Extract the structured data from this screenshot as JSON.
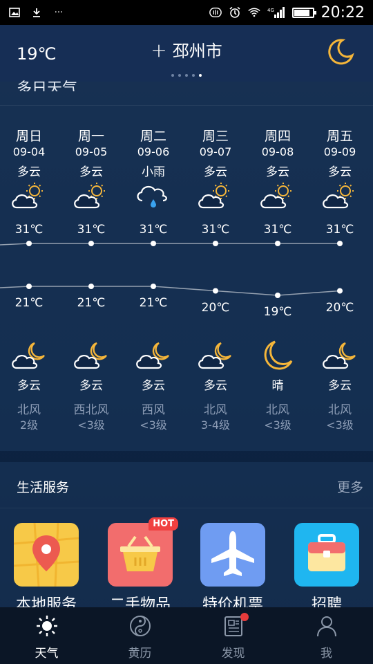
{
  "status_bar": {
    "time": "20:22",
    "network": "4G",
    "icons": [
      "image-icon",
      "download-icon",
      "more-icon",
      "nfc-icon",
      "alarm-icon",
      "wifi-icon",
      "signal-icon",
      "battery-icon"
    ]
  },
  "header": {
    "current_temp": "19℃",
    "city": "邳州市",
    "add_icon": "+",
    "page_count": 5,
    "active_page": 5,
    "moon_icon": "moon-icon"
  },
  "forecast": {
    "title": "多日天气",
    "days": [
      {
        "name": "周日",
        "date": "09-04",
        "day_cond": "多云",
        "day_icon": "partly-cloudy-sun",
        "high": "31℃",
        "low": "21℃",
        "night_icon": "cloud-moon",
        "night_cond": "多云",
        "wind_dir": "北风",
        "wind_level": "2级"
      },
      {
        "name": "周一",
        "date": "09-05",
        "day_cond": "多云",
        "day_icon": "partly-cloudy-sun",
        "high": "31℃",
        "low": "21℃",
        "night_icon": "cloud-moon",
        "night_cond": "多云",
        "wind_dir": "西北风",
        "wind_level": "<3级"
      },
      {
        "name": "周二",
        "date": "09-06",
        "day_cond": "小雨",
        "day_icon": "rain",
        "high": "31℃",
        "low": "21℃",
        "night_icon": "cloud-moon",
        "night_cond": "多云",
        "wind_dir": "西风",
        "wind_level": "<3级"
      },
      {
        "name": "周三",
        "date": "09-07",
        "day_cond": "多云",
        "day_icon": "partly-cloudy-sun",
        "high": "31℃",
        "low": "20℃",
        "night_icon": "cloud-moon",
        "night_cond": "多云",
        "wind_dir": "北风",
        "wind_level": "3-4级"
      },
      {
        "name": "周四",
        "date": "09-08",
        "day_cond": "多云",
        "day_icon": "partly-cloudy-sun",
        "high": "31℃",
        "low": "19℃",
        "night_icon": "moon",
        "night_cond": "晴",
        "wind_dir": "北风",
        "wind_level": "<3级"
      },
      {
        "name": "周五",
        "date": "09-09",
        "day_cond": "多云",
        "day_icon": "partly-cloudy-sun",
        "high": "31℃",
        "low": "20℃",
        "night_icon": "cloud-moon",
        "night_cond": "多云",
        "wind_dir": "北风",
        "wind_level": "<3级"
      }
    ],
    "high_values": [
      31,
      31,
      31,
      31,
      31,
      31
    ],
    "low_values": [
      21,
      21,
      21,
      20,
      19,
      20
    ]
  },
  "services": {
    "title": "生活服务",
    "more": "更多",
    "items": [
      {
        "label": "本地服务",
        "icon": "map-pin-icon",
        "color": "#f7c948"
      },
      {
        "label": "二手物品",
        "icon": "basket-icon",
        "color": "#f26d6d",
        "badge": "HOT"
      },
      {
        "label": "特价机票",
        "icon": "airplane-icon",
        "color": "#6f9cf2"
      },
      {
        "label": "招聘",
        "icon": "briefcase-icon",
        "color": "#1fb6f0"
      }
    ]
  },
  "tabs": [
    {
      "label": "天气",
      "icon": "sun-icon",
      "active": true
    },
    {
      "label": "黄历",
      "icon": "yin-yang-icon",
      "active": false
    },
    {
      "label": "发现",
      "icon": "news-icon",
      "active": false,
      "badge_dot": true
    },
    {
      "label": "我",
      "icon": "person-icon",
      "active": false
    }
  ],
  "colors": {
    "accent_yellow": "#f5b63a",
    "hot_red": "#f04040",
    "muted_text": "#8d9db6"
  }
}
